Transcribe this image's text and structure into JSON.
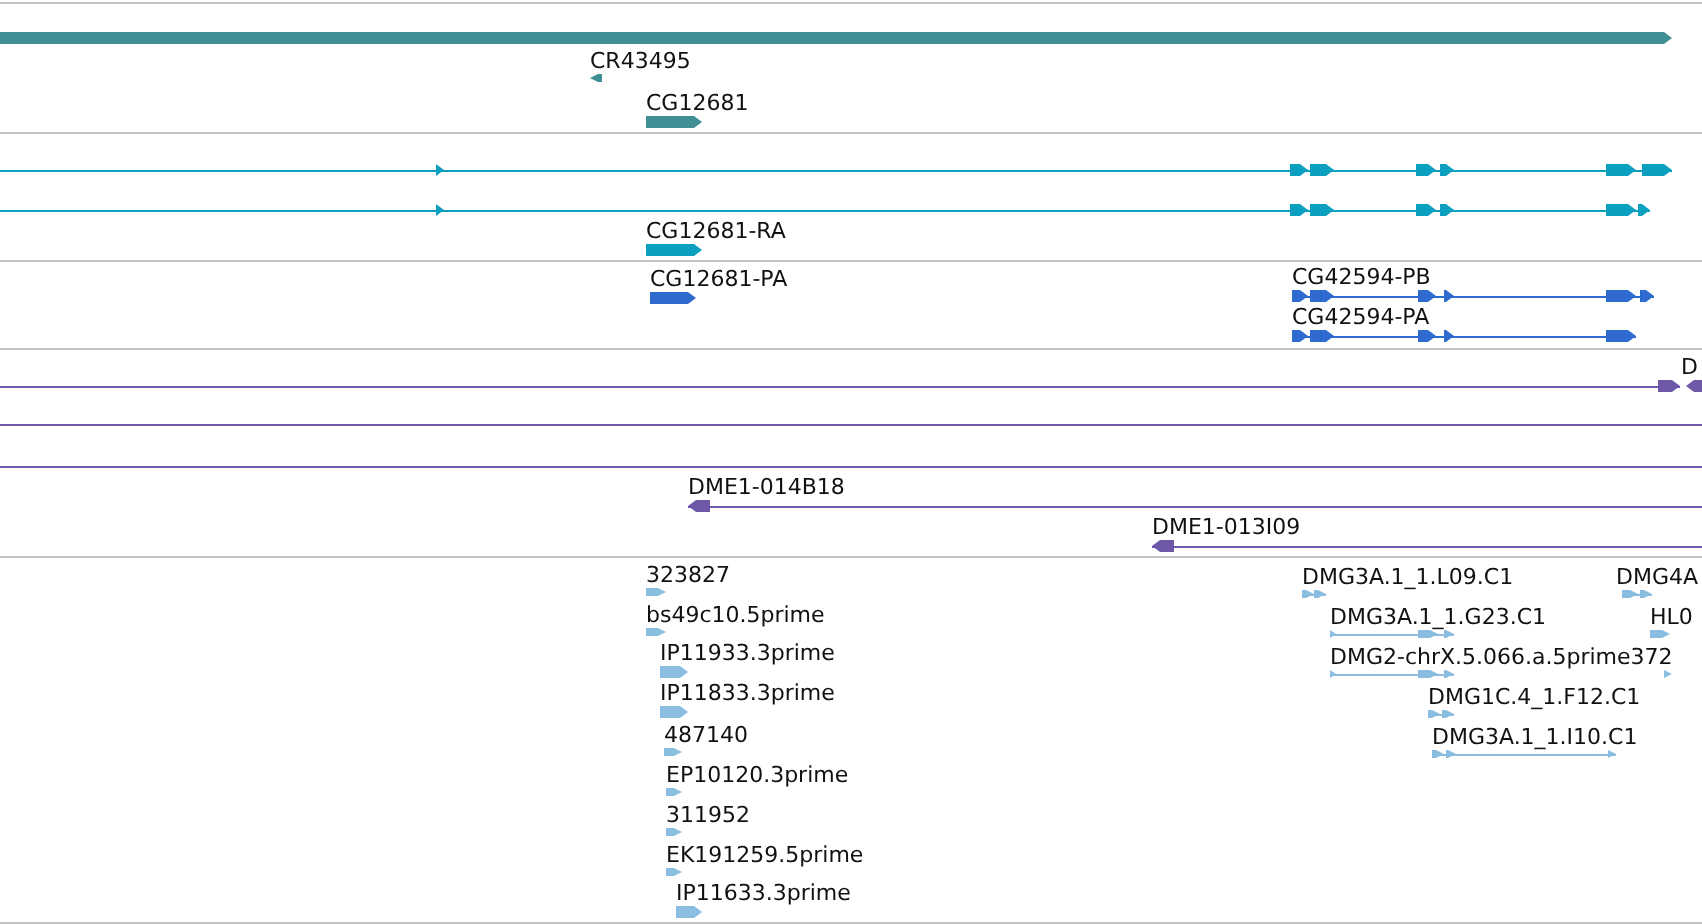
{
  "tracks": [
    {
      "color": "#3f8f94",
      "features": [
        {
          "reverse": false
        },
        {
          "label": "CR43495",
          "reverse": true
        },
        {
          "label": "CG12681",
          "reverse": false
        }
      ]
    },
    {
      "color": "#0b9fc0",
      "features": [
        {
          "reverse": false
        },
        {
          "reverse": false
        },
        {
          "label": "CG12681-RA",
          "reverse": false
        }
      ]
    },
    {
      "color": "#2f6bcf",
      "features": [
        {
          "label": "CG12681-PA",
          "reverse": false
        },
        {
          "label": "CG42594-PB",
          "reverse": false
        },
        {
          "label": "CG42594-PA",
          "reverse": false
        }
      ]
    },
    {
      "color": "#6f58a8",
      "features": [
        {
          "kind": "clone",
          "reverse": false
        },
        {
          "kind": "clone",
          "label": "D",
          "reverse": true
        },
        {
          "kind": "span"
        },
        {
          "kind": "span"
        },
        {
          "kind": "clone",
          "label": "DME1-014B18",
          "reverse": true
        },
        {
          "kind": "clone",
          "label": "DME1-013I09",
          "reverse": true
        }
      ]
    },
    {
      "color": "#8bbde0",
      "features": [
        {
          "label": "323827",
          "reverse": false
        },
        {
          "label": "bs49c10.5prime",
          "reverse": false
        },
        {
          "label": "IP11933.3prime",
          "reverse": false
        },
        {
          "label": "IP11833.3prime",
          "reverse": false
        },
        {
          "label": "487140",
          "reverse": false
        },
        {
          "label": "EP10120.3prime",
          "reverse": false
        },
        {
          "label": "311952",
          "reverse": false
        },
        {
          "label": "EK191259.5prime",
          "reverse": false
        },
        {
          "label": "IP11633.3prime",
          "reverse": false
        },
        {
          "label": "DMG3A.1_1.L09.C1",
          "reverse": false
        },
        {
          "label": "DMG3A.1_1.G23.C1",
          "reverse": false
        },
        {
          "label": "DMG2-chrX.5.066.a.5prime372",
          "reverse": false
        },
        {
          "label": "DMG1C.4_1.F12.C1",
          "reverse": false
        },
        {
          "label": "DMG3A.1_1.I10.C1",
          "reverse": false
        },
        {
          "label": "DMG4A",
          "reverse": false
        },
        {
          "label": "HL0",
          "reverse": false
        },
        {
          "reverse": false
        }
      ]
    }
  ]
}
